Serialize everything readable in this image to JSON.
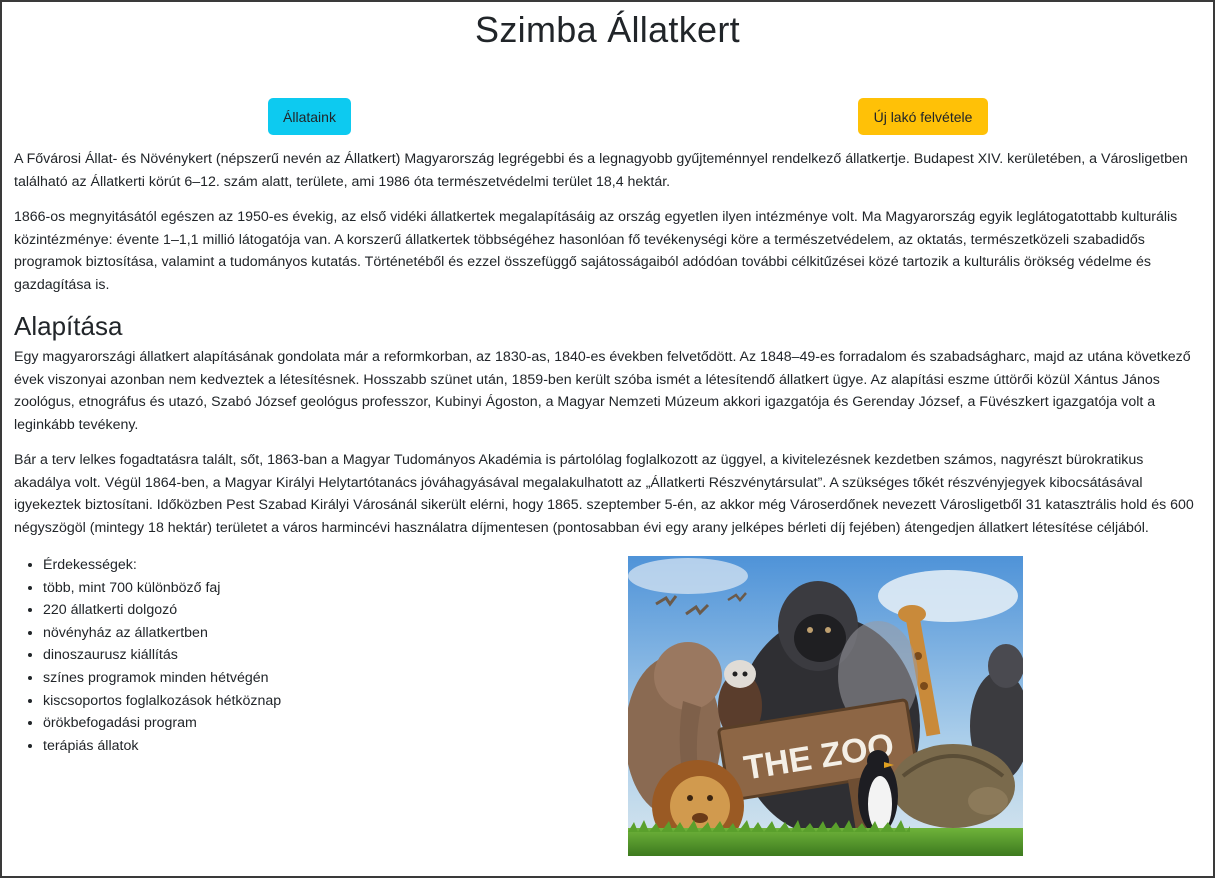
{
  "page": {
    "title": "Szimba Állatkert"
  },
  "buttons": {
    "animals": "Állataink",
    "new_resident": "Új lakó felvétele"
  },
  "intro": {
    "p1": "A Fővárosi Állat- és Növénykert (népszerű nevén az Állatkert) Magyarország legrégebbi és a legnagyobb gyűjteménnyel rendelkező állatkertje. Budapest XIV. kerületében, a Városligetben található az Állatkerti körút 6–12. szám alatt, területe, ami 1986 óta természetvédelmi terület 18,4 hektár.",
    "p2": "1866-os megnyitásától egészen az 1950-es évekig, az első vidéki állatkertek megalapításáig az ország egyetlen ilyen intézménye volt. Ma Magyarország egyik leglátogatottabb kulturális közintézménye: évente 1–1,1 millió látogatója van. A korszerű állatkertek többségéhez hasonlóan fő tevékenységi köre a természetvédelem, az oktatás, természetközeli szabadidős programok biztosítása, valamint a tudományos kutatás. Történetéből és ezzel összefüggő sajátosságaiból adódóan további célkitűzései közé tartozik a kulturális örökség védelme és gazdagítása is."
  },
  "founding": {
    "heading": "Alapítása",
    "p1": "Egy magyarországi állatkert alapításának gondolata már a reformkorban, az 1830-as, 1840-es években felvetődött. Az 1848–49-es forradalom és szabadságharc, majd az utána következő évek viszonyai azonban nem kedveztek a létesítésnek. Hosszabb szünet után, 1859-ben került szóba ismét a létesítendő állatkert ügye. Az alapítási eszme úttörői közül Xántus János zoológus, etnográfus és utazó, Szabó József geológus professzor, Kubinyi Ágoston, a Magyar Nemzeti Múzeum akkori igazgatója és Gerenday József, a Füvészkert igazgatója volt a leginkább tevékeny.",
    "p2": "Bár a terv lelkes fogadtatásra talált, sőt, 1863-ban a Magyar Tudományos Akadémia is pártolólag foglalkozott az üggyel, a kivitelezésnek kezdetben számos, nagyrészt bürokratikus akadálya volt. Végül 1864-ben, a Magyar Királyi Helytartótanács jóváhagyásával megalakulhatott az „Állatkerti Részvénytársulat”. A szükséges tőkét részvényjegyek kibocsátásával igyekeztek biztosítani. Időközben Pest Szabad Királyi Városánál sikerült elérni, hogy 1865. szeptember 5-én, az akkor még Városerdőnek nevezett Városligetből 31 katasztrális hold és 600 négyszögöl (mintegy 18 hektár) területet a város harmincévi használatra díjmentesen (pontosabban évi egy arany jelképes bérleti díj fejében) átengedjen állatkert létesítése céljából."
  },
  "features": [
    "Érdekességek:",
    "több, mint 700 különböző faj",
    "220 állatkerti dolgozó",
    "növényház az állatkertben",
    "dinoszaurusz kiállítás",
    "színes programok minden hétvégén",
    "kiscsoportos foglalkozások hétköznap",
    "örökbefogadási program",
    "terápiás állatok"
  ],
  "image": {
    "sign_text": "THE ZOO"
  },
  "colors": {
    "info": "#0dcaf0",
    "warning": "#ffc107",
    "text": "#212529"
  }
}
